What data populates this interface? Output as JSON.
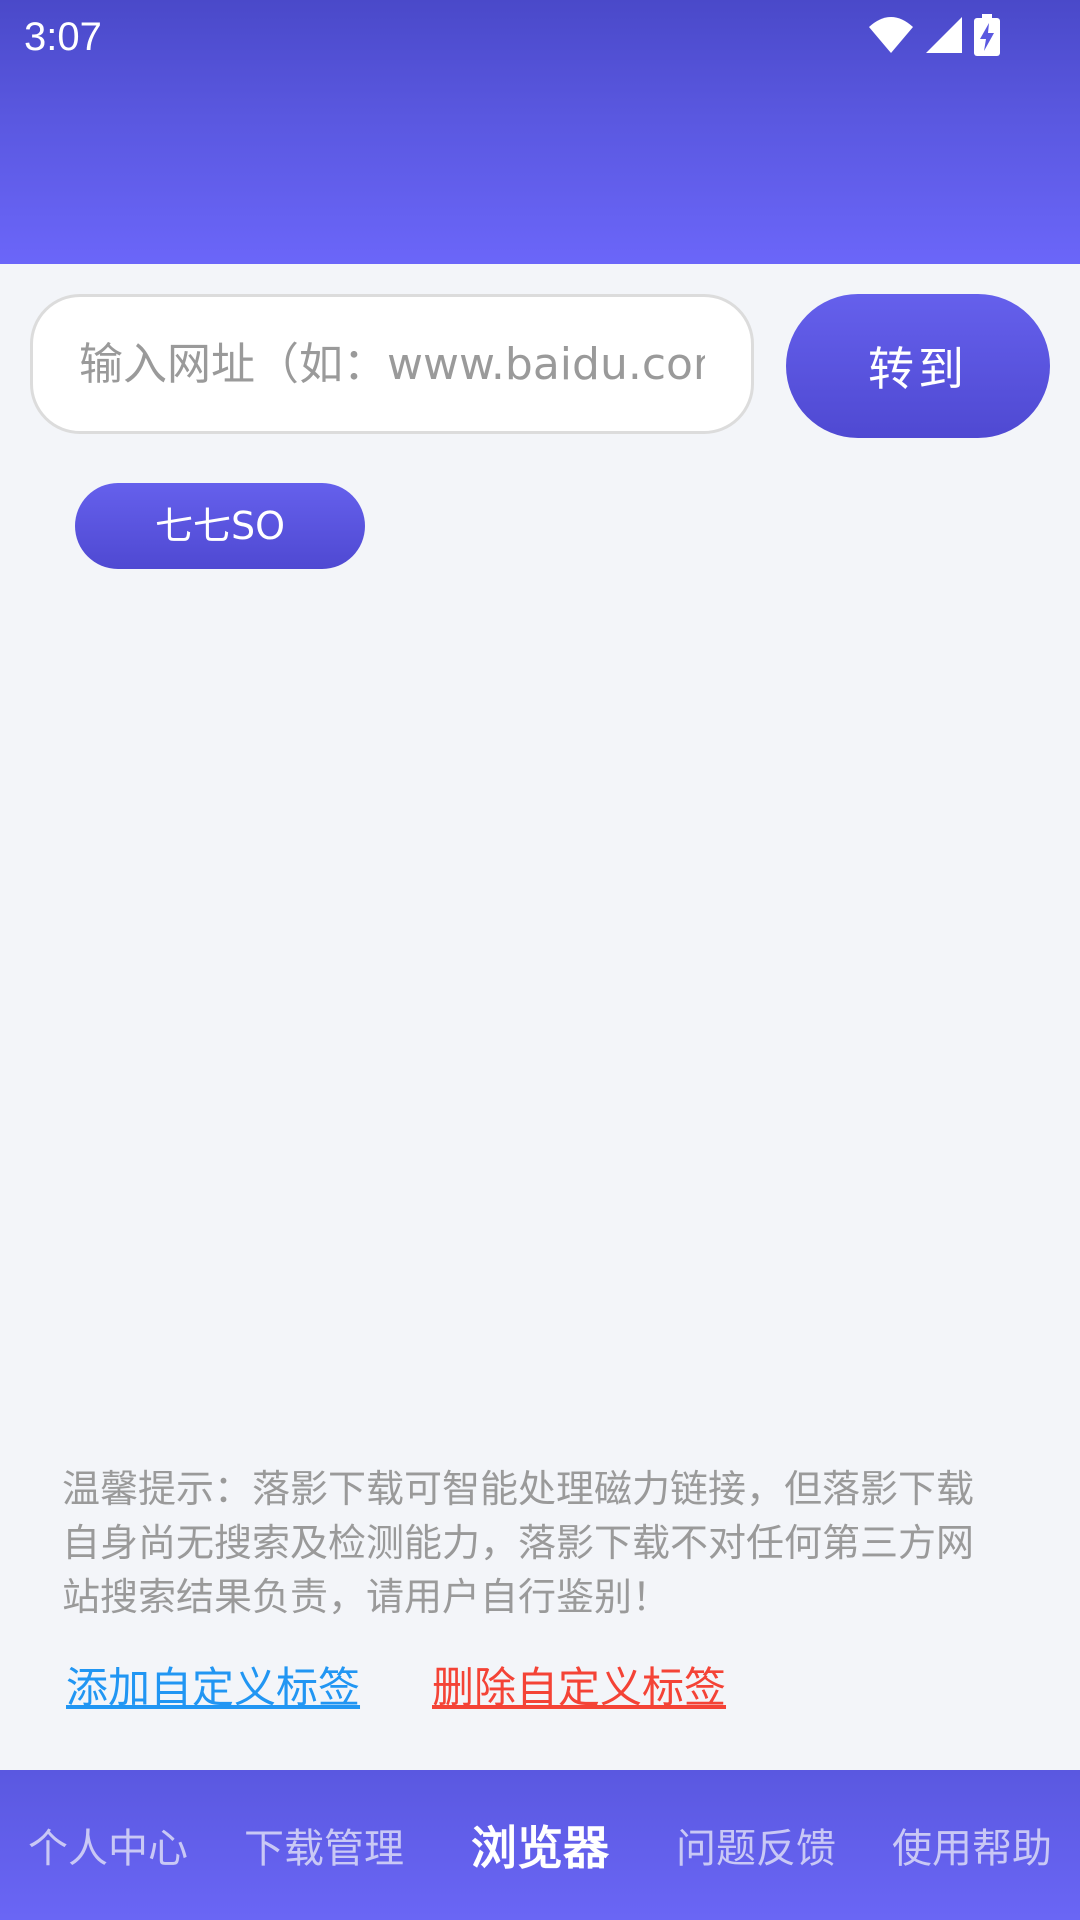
{
  "status_bar": {
    "time": "3:07"
  },
  "address_bar": {
    "placeholder": "输入网址（如：www.baidu.com）",
    "value": "",
    "go_label": "转到"
  },
  "tags": [
    {
      "label": "七七SO"
    }
  ],
  "notice": "温馨提示：落影下载可智能处理磁力链接，但落影下载自身尚无搜索及检测能力，落影下载不对任何第三方网站搜索结果负责，请用户自行鉴别！",
  "links": {
    "add_label": "添加自定义标签",
    "delete_label": "删除自定义标签"
  },
  "bottom_nav": {
    "items": [
      {
        "label": "个人中心"
      },
      {
        "label": "下载管理"
      },
      {
        "label": "浏览器"
      },
      {
        "label": "问题反馈"
      },
      {
        "label": "使用帮助"
      }
    ],
    "active_index": 2
  },
  "colors": {
    "accent": "#5a58e0",
    "link_add": "#2196f3",
    "link_delete": "#f44336"
  }
}
